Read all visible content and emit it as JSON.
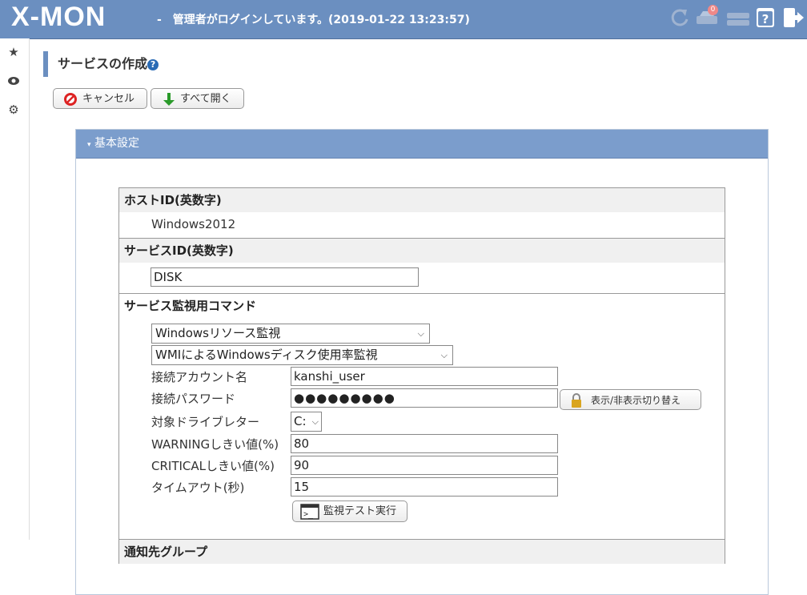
{
  "header": {
    "logo": "X-MON",
    "login_message": "-　管理者がログインしています。(2019-01-22 13:23:57)",
    "notification_count": "0"
  },
  "sidebar": {
    "items": [
      {
        "icon": "star-icon"
      },
      {
        "icon": "eye-icon"
      },
      {
        "icon": "gear-icon"
      }
    ]
  },
  "page": {
    "title": "サービスの作成",
    "help": "?"
  },
  "toolbar": {
    "cancel_label": "キャンセル",
    "expand_label": "すべて開く"
  },
  "panel": {
    "title": "基本設定"
  },
  "form": {
    "host_id": {
      "label": "ホストID(英数字)",
      "value": "Windows2012"
    },
    "service_id": {
      "label": "サービスID(英数字)",
      "value": "DISK"
    },
    "command": {
      "label": "サービス監視用コマンド",
      "category": "Windowsリソース監視",
      "plugin": "WMIによるWindowsディスク使用率監視",
      "account_label": "接続アカウント名",
      "account_value": "kanshi_user",
      "password_label": "接続パスワード",
      "password_value": "●●●●●●●●●",
      "toggle_label": "表示/非表示切り替え",
      "drive_label": "対象ドライブレター",
      "drive_value": "C:",
      "warning_label": "WARNINGしきい値(%)",
      "warning_value": "80",
      "critical_label": "CRITICALしきい値(%)",
      "critical_value": "90",
      "timeout_label": "タイムアウト(秒)",
      "timeout_value": "15",
      "test_label": "監視テスト実行"
    },
    "notify_group": {
      "label": "通知先グループ"
    }
  }
}
